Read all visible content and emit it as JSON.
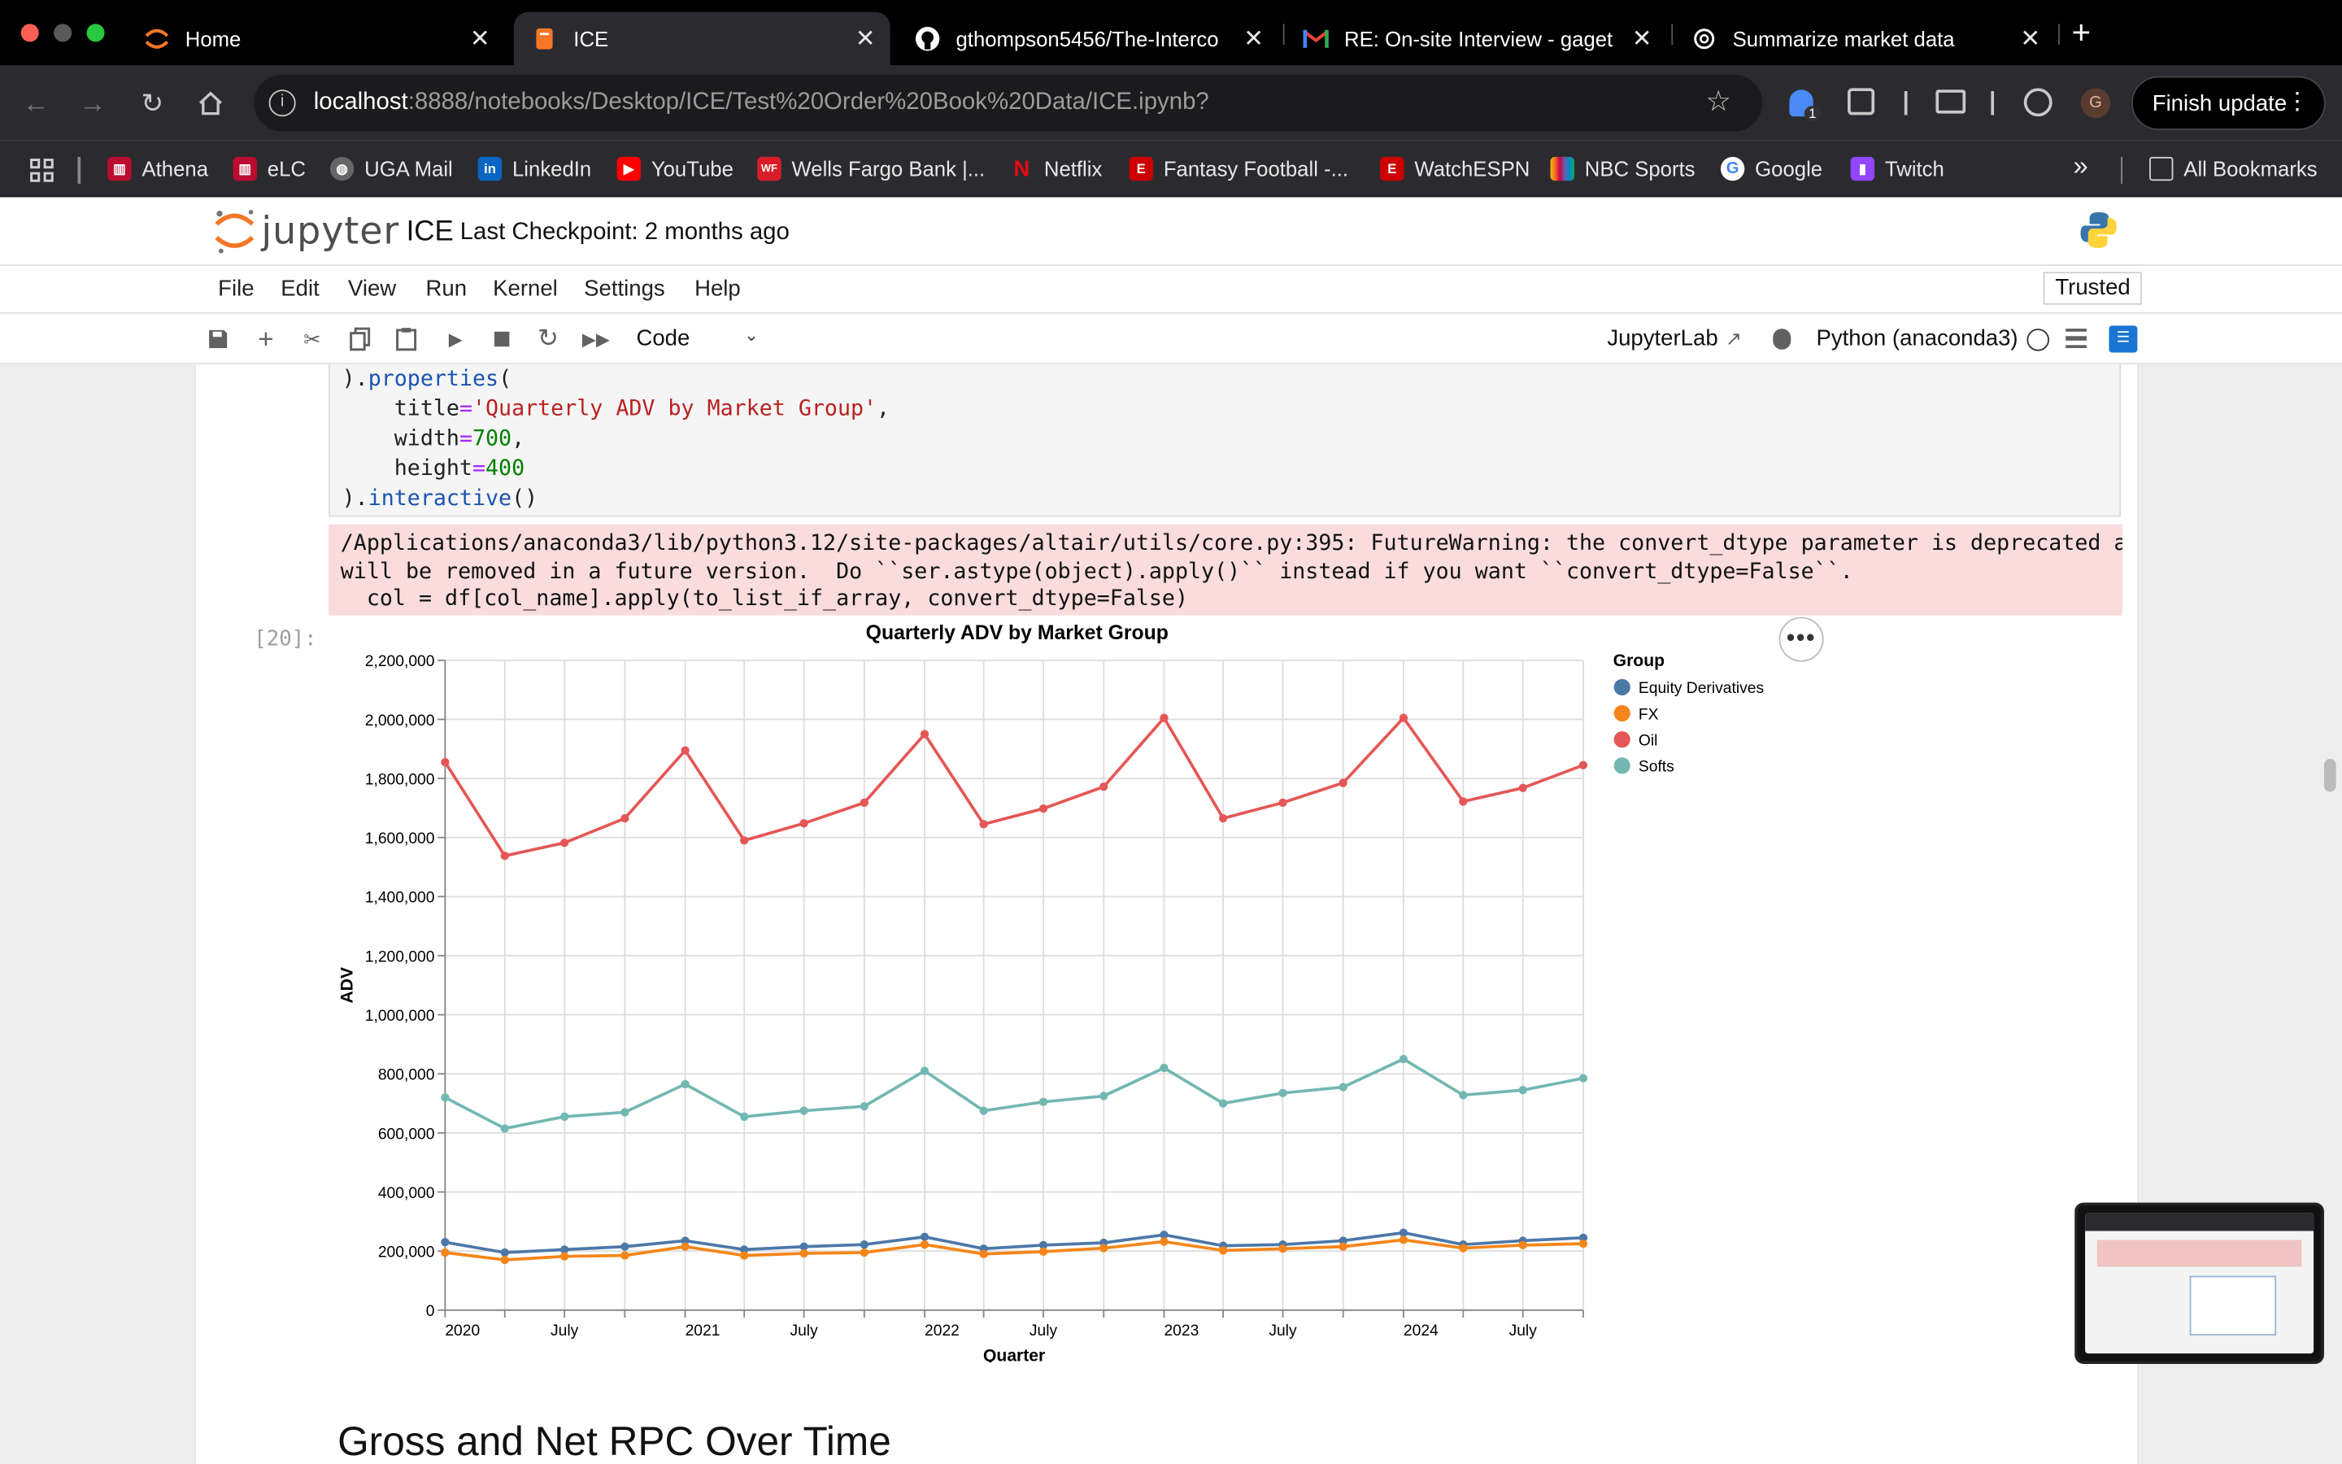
{
  "browser": {
    "tabs": [
      {
        "label": "Home",
        "icon": "jupyter-icon",
        "active": false
      },
      {
        "label": "ICE",
        "icon": "notebook-icon",
        "active": true
      },
      {
        "label": "gthompson5456/The-Interco",
        "icon": "github-icon",
        "active": false
      },
      {
        "label": "RE: On-site Interview - gaget",
        "icon": "gmail-icon",
        "active": false
      },
      {
        "label": "Summarize market data",
        "icon": "chatgpt-icon",
        "active": false
      }
    ],
    "new_tab": "+",
    "url_host": "localhost",
    "url_path": ":8888/notebooks/Desktop/ICE/Test%20Order%20Book%20Data/ICE.ipynb?",
    "extension_badge": "1",
    "profile_initial": "G",
    "finish_update": "Finish update",
    "bookmarks": [
      "Athena",
      "eLC",
      "UGA Mail",
      "LinkedIn",
      "YouTube",
      "Wells Fargo Bank |...",
      "Netflix",
      "Fantasy Football -...",
      "WatchESPN",
      "NBC Sports",
      "Google",
      "Twitch"
    ],
    "all_bookmarks": "All Bookmarks",
    "more": "»"
  },
  "jupyter": {
    "logo_text": "jupyter",
    "notebook_name": "ICE",
    "checkpoint": "Last Checkpoint: 2 months ago",
    "menu": [
      "File",
      "Edit",
      "View",
      "Run",
      "Kernel",
      "Settings",
      "Help"
    ],
    "trusted": "Trusted",
    "cell_type": "Code",
    "jupyterlab": "JupyterLab",
    "kernel": "Python (anaconda3)"
  },
  "cell": {
    "code_lines": [
      ").properties(",
      "    title='Quarterly ADV by Market Group',",
      "    width=700,",
      "    height=400",
      ").interactive()"
    ],
    "warning_lines": [
      "/Applications/anaconda3/lib/python3.12/site-packages/altair/utils/core.py:395: FutureWarning: the convert_dtype parameter is deprecated and",
      "will be removed in a future version.  Do ``ser.astype(object).apply()`` instead if you want ``convert_dtype=False``.",
      "  col = df[col_name].apply(to_list_if_array, convert_dtype=False)"
    ],
    "prompt": "[20]:",
    "actions": "•••"
  },
  "next_heading": "Gross and Net RPC Over Time",
  "chart_data": {
    "type": "line",
    "title": "Quarterly ADV by Market Group",
    "xlabel": "Quarter",
    "ylabel": "ADV",
    "legend_title": "Group",
    "legend_position": "right",
    "ylim": [
      0,
      2200000
    ],
    "y_ticks": [
      0,
      200000,
      400000,
      600000,
      800000,
      1000000,
      1200000,
      1400000,
      1600000,
      1800000,
      2000000,
      2200000
    ],
    "y_tick_labels": [
      "0",
      "200,000",
      "400,000",
      "600,000",
      "800,000",
      "1,000,000",
      "1,200,000",
      "1,400,000",
      "1,600,000",
      "1,800,000",
      "2,000,000",
      "2,200,000"
    ],
    "x_tick_labels": [
      "2020",
      "July",
      "2021",
      "July",
      "2022",
      "July",
      "2023",
      "July",
      "2024",
      "July"
    ],
    "grid": true,
    "x": [
      "2020-01-01",
      "2020-04-01",
      "2020-07-01",
      "2020-10-01",
      "2021-01-01",
      "2021-04-01",
      "2021-07-01",
      "2021-10-01",
      "2022-01-01",
      "2022-04-01",
      "2022-07-01",
      "2022-10-01",
      "2023-01-01",
      "2023-04-01",
      "2023-07-01",
      "2023-10-01",
      "2024-01-01",
      "2024-04-01",
      "2024-07-01",
      "2024-10-01"
    ],
    "series": [
      {
        "name": "Equity Derivatives",
        "color": "#4c78a8",
        "values": [
          230000,
          195000,
          205000,
          215000,
          235000,
          205000,
          215000,
          222000,
          248000,
          208000,
          220000,
          228000,
          255000,
          218000,
          222000,
          235000,
          262000,
          222000,
          235000,
          245000
        ]
      },
      {
        "name": "FX",
        "color": "#f58518",
        "values": [
          195000,
          170000,
          182000,
          185000,
          215000,
          185000,
          192000,
          195000,
          222000,
          190000,
          198000,
          210000,
          232000,
          202000,
          208000,
          215000,
          238000,
          210000,
          220000,
          225000
        ]
      },
      {
        "name": "Oil",
        "color": "#e45756",
        "values": [
          1855000,
          1538000,
          1582000,
          1665000,
          1895000,
          1590000,
          1648000,
          1718000,
          1950000,
          1645000,
          1698000,
          1772000,
          2005000,
          1665000,
          1718000,
          1785000,
          2005000,
          1722000,
          1768000,
          1845000
        ]
      },
      {
        "name": "Softs",
        "color": "#72b7b2",
        "values": [
          720000,
          615000,
          655000,
          670000,
          765000,
          655000,
          675000,
          690000,
          810000,
          675000,
          705000,
          725000,
          820000,
          700000,
          735000,
          755000,
          850000,
          728000,
          745000,
          785000
        ]
      }
    ]
  }
}
